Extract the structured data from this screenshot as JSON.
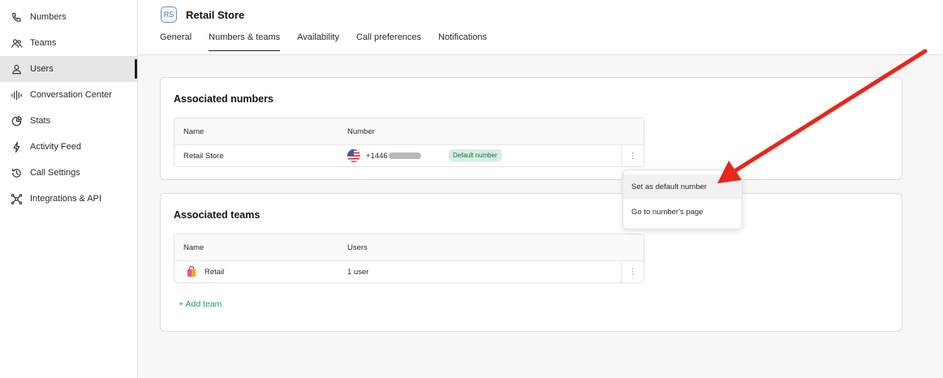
{
  "sidebar": {
    "items": [
      {
        "label": "Numbers",
        "icon": "phone-icon"
      },
      {
        "label": "Teams",
        "icon": "people-icon"
      },
      {
        "label": "Users",
        "icon": "user-icon",
        "active": true
      },
      {
        "label": "Conversation Center",
        "icon": "waveform-icon"
      },
      {
        "label": "Stats",
        "icon": "pie-chart-icon"
      },
      {
        "label": "Activity Feed",
        "icon": "lightning-icon"
      },
      {
        "label": "Call Settings",
        "icon": "history-icon"
      },
      {
        "label": "Integrations & API",
        "icon": "network-icon"
      }
    ]
  },
  "header": {
    "avatar_initials": "RS",
    "title": "Retail Store",
    "tabs": [
      {
        "label": "General"
      },
      {
        "label": "Numbers & teams",
        "active": true
      },
      {
        "label": "Availability"
      },
      {
        "label": "Call preferences"
      },
      {
        "label": "Notifications"
      }
    ]
  },
  "numbers_card": {
    "title": "Associated numbers",
    "columns": {
      "name": "Name",
      "number": "Number"
    },
    "rows": [
      {
        "name": "Retail Store",
        "number_visible": "+1446",
        "badge": "Default number",
        "flag": "us-flag-icon"
      }
    ]
  },
  "teams_card": {
    "title": "Associated teams",
    "columns": {
      "name": "Name",
      "users": "Users"
    },
    "rows": [
      {
        "name": "Retail",
        "users": "1 user",
        "icon": "shopping-bag-icon"
      }
    ],
    "add_label": "+ Add team"
  },
  "menu": {
    "items": [
      {
        "label": "Set as default number"
      },
      {
        "label": "Go to number's page"
      }
    ]
  },
  "colors": {
    "accent_green": "#1e9c6d",
    "badge_bg": "#d5efe3",
    "annotation_red": "#e8261c"
  }
}
